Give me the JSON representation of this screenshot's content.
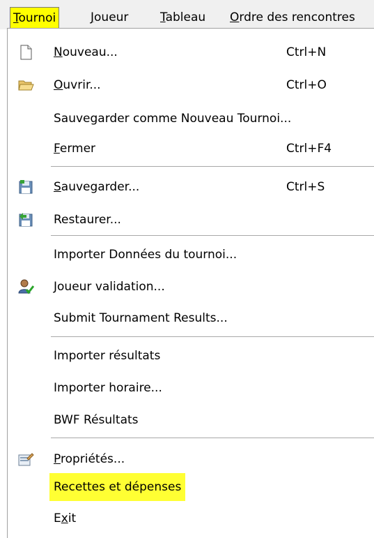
{
  "menubar": {
    "items": [
      {
        "label": "Tournoi",
        "mnemonic_index": 0,
        "active": true
      },
      {
        "label": "Joueur",
        "mnemonic_index": 0,
        "active": false
      },
      {
        "label": "Tableau",
        "mnemonic_index": 0,
        "active": false
      },
      {
        "label": "Ordre des rencontres",
        "mnemonic_index": 0,
        "active": false
      }
    ]
  },
  "menu": {
    "items": [
      {
        "label": "Nouveau...",
        "shortcut": "Ctrl+N",
        "icon": "new-document-icon"
      },
      {
        "label": "Ouvrir...",
        "shortcut": "Ctrl+O",
        "icon": "open-folder-icon"
      },
      {
        "label": "Sauvegarder comme Nouveau Tournoi...",
        "shortcut": ""
      },
      {
        "label": "Fermer",
        "shortcut": "Ctrl+F4"
      },
      {
        "label": "Sauvegarder...",
        "shortcut": "Ctrl+S",
        "icon": "save-disk-icon"
      },
      {
        "label": "Restaurer...",
        "shortcut": "",
        "icon": "restore-disk-icon"
      },
      {
        "label": "Importer Données du tournoi...",
        "shortcut": ""
      },
      {
        "label": "Joueur validation...",
        "shortcut": "",
        "icon": "user-check-icon"
      },
      {
        "label": "Submit Tournament Results...",
        "shortcut": ""
      },
      {
        "label": "Importer résultats",
        "shortcut": ""
      },
      {
        "label": "Importer horaire...",
        "shortcut": ""
      },
      {
        "label": "BWF Résultats",
        "shortcut": ""
      },
      {
        "label": "Propriétés...",
        "shortcut": "",
        "icon": "properties-icon"
      },
      {
        "label": "Recettes et dépenses",
        "shortcut": "",
        "highlighted": true
      },
      {
        "label": "Exit",
        "shortcut": ""
      }
    ]
  },
  "colors": {
    "highlight": "#ffff00",
    "menubar_bg": "#f0f0f0",
    "separator": "#a8a8a8"
  }
}
